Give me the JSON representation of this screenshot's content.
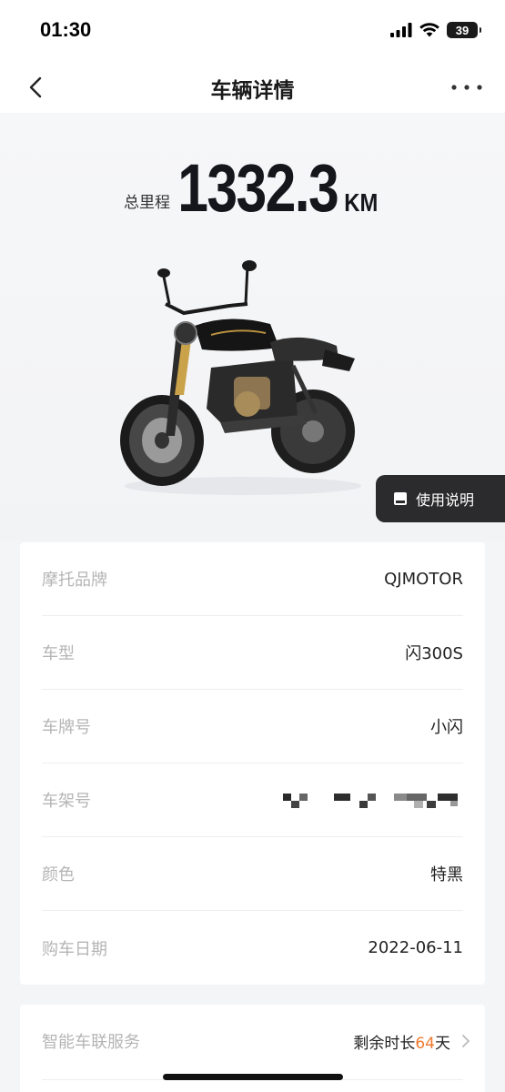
{
  "status_bar": {
    "time": "01:30",
    "battery": "39"
  },
  "nav": {
    "title": "车辆详情"
  },
  "hero": {
    "mileage_label": "总里程",
    "mileage_value": "1332.3",
    "mileage_unit": "KM",
    "manual_button": "使用说明"
  },
  "info": {
    "rows": [
      {
        "label": "摩托品牌",
        "value": "QJMOTOR"
      },
      {
        "label": "车型",
        "value": "闪300S"
      },
      {
        "label": "车牌号",
        "value": "小闪"
      },
      {
        "label": "车架号",
        "value": ""
      },
      {
        "label": "颜色",
        "value": "特黑"
      },
      {
        "label": "购车日期",
        "value": "2022-06-11"
      }
    ]
  },
  "service": {
    "label": "智能车联服务",
    "prefix": "剩余时长",
    "days": "64",
    "suffix": "天",
    "accent_color": "#f07a30"
  },
  "icons": [
    "back-chevron-icon",
    "more-dots-icon",
    "book-icon",
    "chevron-right-icon",
    "signal-icon",
    "wifi-icon",
    "battery-icon"
  ]
}
